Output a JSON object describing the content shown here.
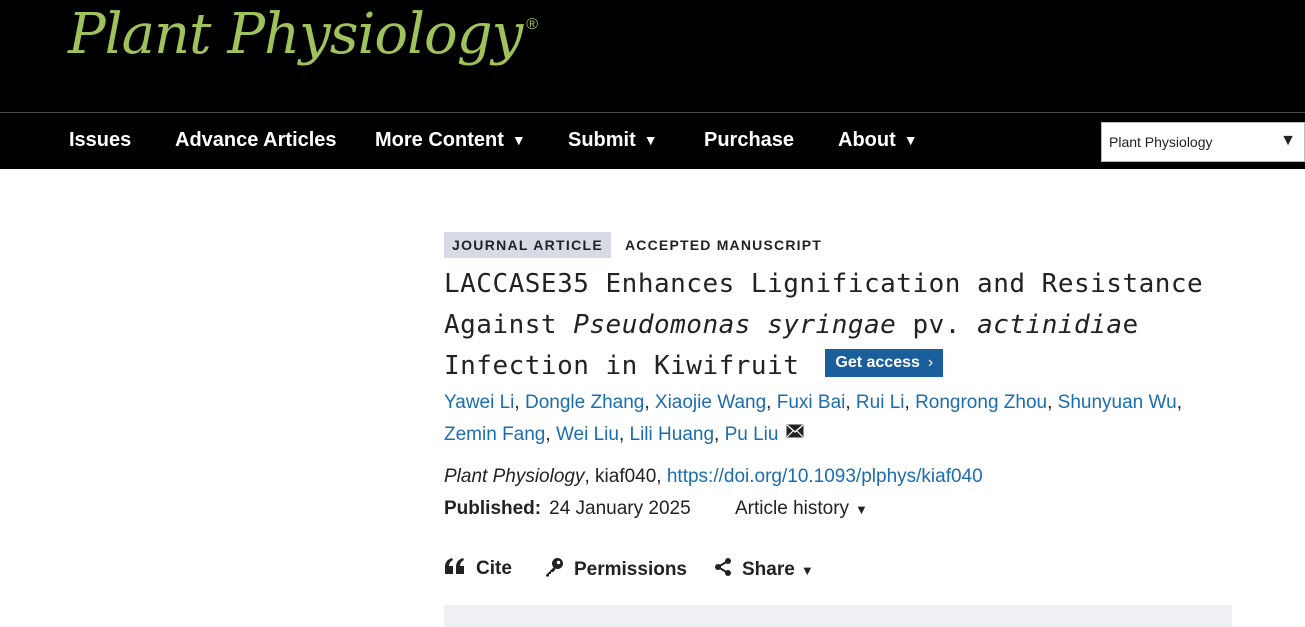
{
  "brand": {
    "name": "Plant Physiology",
    "mark": "®",
    "color": "#9fc25a"
  },
  "nav": {
    "items": [
      {
        "label": "Issues",
        "dropdown": false
      },
      {
        "label": "Advance Articles",
        "dropdown": false
      },
      {
        "label": "More Content",
        "dropdown": true
      },
      {
        "label": "Submit",
        "dropdown": true
      },
      {
        "label": "Purchase",
        "dropdown": false
      },
      {
        "label": "About",
        "dropdown": true
      }
    ],
    "caret": "▼",
    "site_select": {
      "value": "Plant Physiology",
      "arrow": "▼"
    }
  },
  "article": {
    "type": "JOURNAL ARTICLE",
    "status": "ACCEPTED MANUSCRIPT",
    "title_parts": [
      "LACCASE35 Enhances Lignification and Resistance Against ",
      "Pseudomonas syringae",
      " pv. ",
      "actinidia",
      "e Infection in Kiwifruit"
    ],
    "get_access": {
      "label": "Get access",
      "chevron": "›",
      "color": "#1a5f9c"
    },
    "authors": [
      "Yawei Li",
      "Dongle Zhang",
      "Xiaojie Wang",
      "Fuxi Bai",
      "Rui Li",
      "Rongrong Zhou",
      "Shunyuan Wu",
      "Zemin Fang",
      "Wei Liu",
      "Lili Huang",
      "Pu Liu"
    ],
    "author_separator": ", ",
    "corresponding_icon": "envelope-icon",
    "citation": {
      "journal": "Plant Physiology",
      "id_prefix": ", kiaf040, ",
      "doi": "https://doi.org/10.1093/plphys/kiaf040"
    },
    "published_label": "Published:",
    "published_date": "24 January 2025",
    "history_label": "Article history",
    "history_caret": "▼"
  },
  "tools": {
    "cite": "Cite",
    "permissions": "Permissions",
    "share": "Share",
    "share_caret": "▼"
  },
  "colors": {
    "link": "#1a6db0",
    "tag_bg": "#d6dbe6",
    "header_bg": "#000000"
  }
}
